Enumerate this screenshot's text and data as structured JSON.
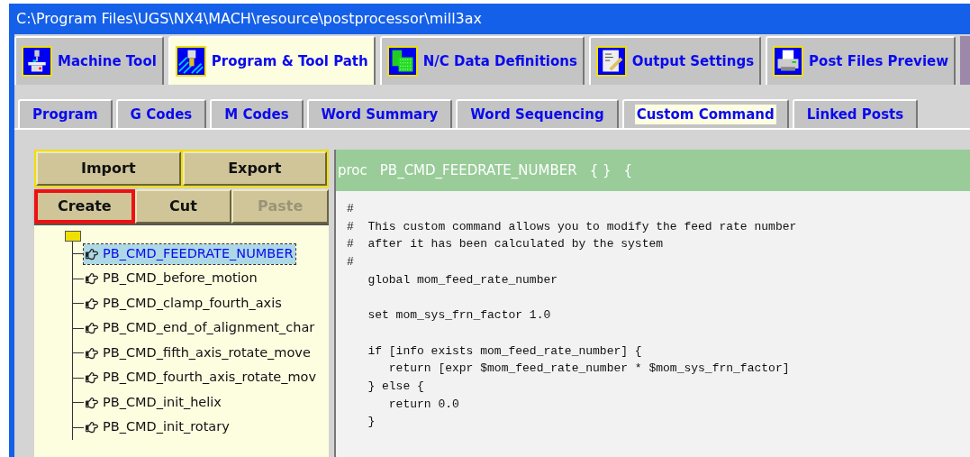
{
  "window": {
    "title": "C:\\Program Files\\UGS\\NX4\\MACH\\resource\\postprocessor\\mill3ax"
  },
  "main_tabs": [
    {
      "label": "Machine Tool",
      "kind": "machine",
      "selected": false
    },
    {
      "label": "Program & Tool Path",
      "kind": "mill",
      "selected": true
    },
    {
      "label": "N/C Data Definitions",
      "kind": "data",
      "selected": false
    },
    {
      "label": "Output Settings",
      "kind": "notepad",
      "selected": false
    },
    {
      "label": "Post Files Preview",
      "kind": "printer",
      "selected": false
    }
  ],
  "sub_tabs": [
    {
      "label": "Program",
      "selected": false
    },
    {
      "label": "G Codes",
      "selected": false
    },
    {
      "label": "M Codes",
      "selected": false
    },
    {
      "label": "Word Summary",
      "selected": false
    },
    {
      "label": "Word Sequencing",
      "selected": false
    },
    {
      "label": "Custom Command",
      "selected": true
    },
    {
      "label": "Linked Posts",
      "selected": false
    }
  ],
  "file_buttons": [
    "Import",
    "Export"
  ],
  "edit_buttons": [
    {
      "label": "Create",
      "disabled": false,
      "highlighted": true
    },
    {
      "label": "Cut",
      "disabled": false,
      "highlighted": false
    },
    {
      "label": "Paste",
      "disabled": true,
      "highlighted": false
    }
  ],
  "tree": {
    "items": [
      {
        "label": "PB_CMD_FEEDRATE_NUMBER",
        "selected": true
      },
      {
        "label": "PB_CMD_before_motion",
        "selected": false
      },
      {
        "label": "PB_CMD_clamp_fourth_axis",
        "selected": false
      },
      {
        "label": "PB_CMD_end_of_alignment_char",
        "selected": false
      },
      {
        "label": "PB_CMD_fifth_axis_rotate_move",
        "selected": false
      },
      {
        "label": "PB_CMD_fourth_axis_rotate_mov",
        "selected": false
      },
      {
        "label": "PB_CMD_init_helix",
        "selected": false
      },
      {
        "label": "PB_CMD_init_rotary",
        "selected": false
      }
    ]
  },
  "editor": {
    "header": {
      "keyword": "proc",
      "name": "PB_CMD_FEEDRATE_NUMBER",
      "args": "{ }",
      "brace": "{"
    },
    "blocks": [
      [
        "#",
        "#  This custom command allows you to modify the feed rate number",
        "#  after it has been calculated by the system",
        "#",
        "   global mom_feed_rate_number"
      ],
      [
        "   set mom_sys_frn_factor 1.0"
      ],
      [
        "   if [info exists mom_feed_rate_number] {",
        "      return [expr $mom_feed_rate_number * $mom_sys_frn_factor]",
        "   } else {",
        "      return 0.0",
        "   }"
      ]
    ]
  }
}
